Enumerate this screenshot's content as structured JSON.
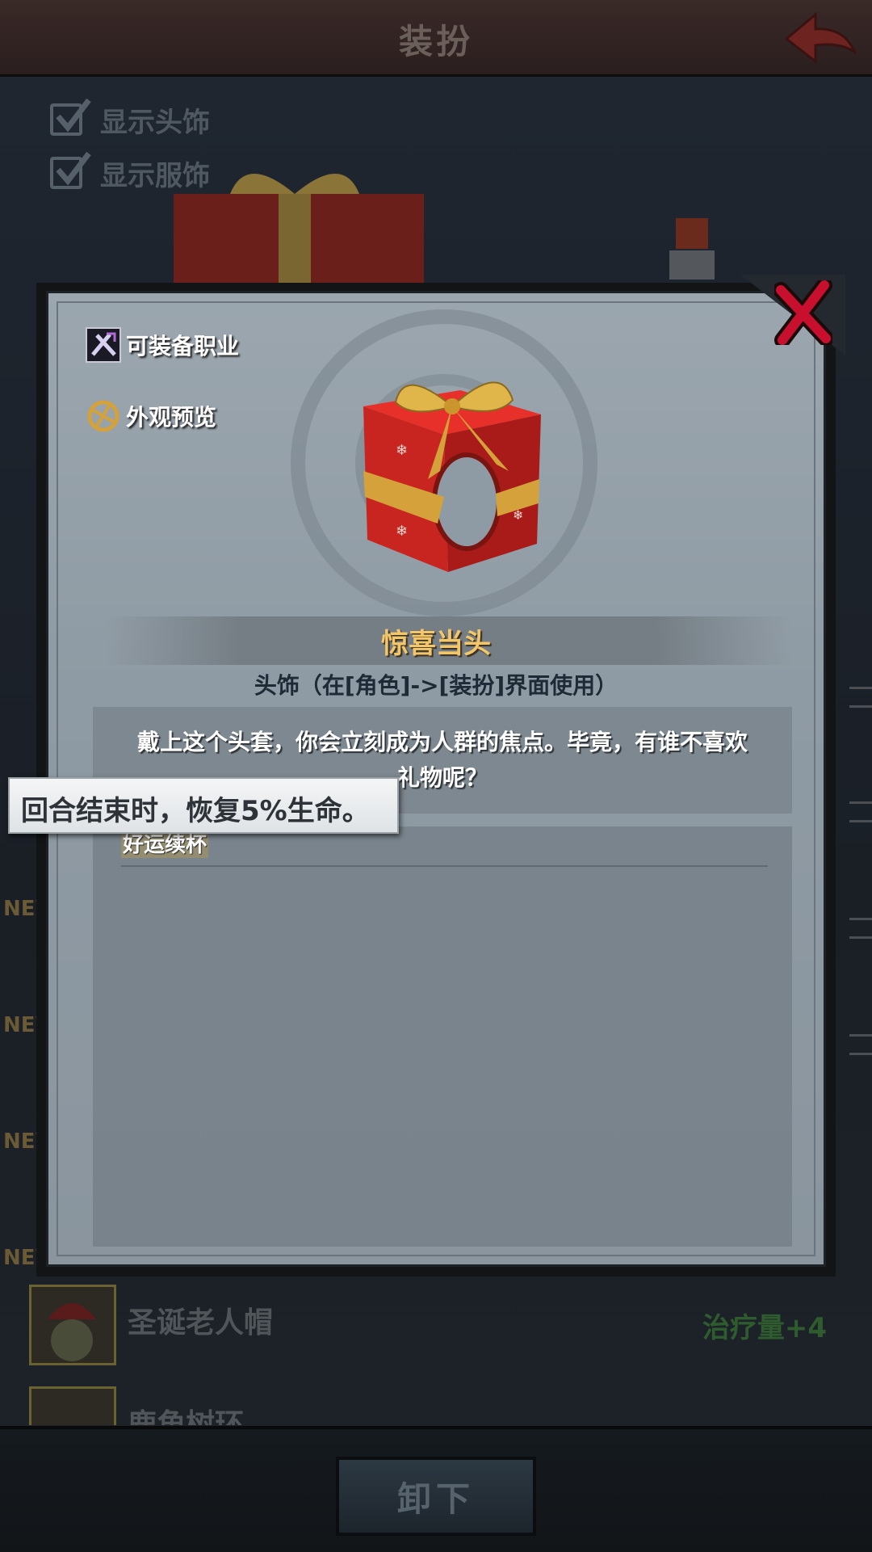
{
  "header": {
    "title": "装扮"
  },
  "toggles": [
    {
      "label": "显示头饰",
      "checked": true
    },
    {
      "label": "显示服饰",
      "checked": true
    }
  ],
  "list": {
    "new_tag": "NEW",
    "items": [
      {
        "name": "圣诞老人帽",
        "stat": "治疗量+4"
      },
      {
        "name": "鹿角树环",
        "stat": ""
      }
    ]
  },
  "bottom": {
    "unequip_label": "卸下"
  },
  "modal": {
    "tags": [
      {
        "label": "可装备职业",
        "icon": "class-icon"
      },
      {
        "label": "外观预览",
        "icon": "preview-icon"
      }
    ],
    "item_name": "惊喜当头",
    "item_type": "头饰（在[角色]->[装扮]界面使用）",
    "description": "戴上这个头套，你会立刻成为人群的焦点。毕竟，有谁不喜欢礼物呢？",
    "effect_name": "好运续杯"
  },
  "tooltip": {
    "text": "回合结束时，恢复5%生命。"
  },
  "colors": {
    "item_name": "#f3c66a",
    "stat_green": "#2f5c2e",
    "close_red": "#c8102e"
  }
}
